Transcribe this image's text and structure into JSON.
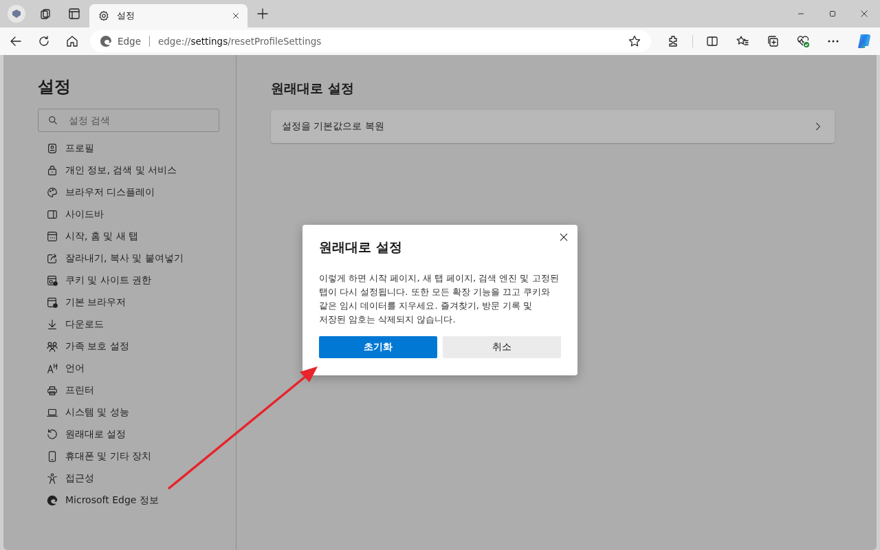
{
  "window": {
    "tabs": [
      {
        "label": "설정",
        "selected": true
      }
    ],
    "address": {
      "site_label": "Edge",
      "url_prefix": "edge://",
      "url_host": "settings",
      "url_path": "/resetProfileSettings"
    }
  },
  "sidebar": {
    "title": "설정",
    "search": {
      "placeholder": "설정 검색"
    },
    "items": [
      {
        "label": "프로필"
      },
      {
        "label": "개인 정보, 검색 및 서비스"
      },
      {
        "label": "브라우저 디스플레이"
      },
      {
        "label": "사이드바"
      },
      {
        "label": "시작, 홈 및 새 탭"
      },
      {
        "label": "잘라내기, 복사 및 붙여넣기"
      },
      {
        "label": "쿠키 및 사이트 권한"
      },
      {
        "label": "기본 브라우저"
      },
      {
        "label": "다운로드"
      },
      {
        "label": "가족 보호 설정"
      },
      {
        "label": "언어"
      },
      {
        "label": "프린터"
      },
      {
        "label": "시스템 및 성능"
      },
      {
        "label": "원래대로 설정"
      },
      {
        "label": "휴대폰 및 기타 장치"
      },
      {
        "label": "접근성"
      },
      {
        "label": "Microsoft Edge 정보"
      }
    ]
  },
  "main": {
    "title": "원래대로 설정",
    "rows": [
      {
        "label": "설정을 기본값으로 복원"
      }
    ]
  },
  "dialog": {
    "title": "원래대로 설정",
    "body": "이렇게 하면 시작 페이지, 새 탭 페이지, 검색 엔진 및 고정된 탭이 다시 설정됩니다. 또한 모든 확장 기능을 끄고 쿠키와 같은 임시 데이터를 지우세요. 즐겨찾기, 방문 기록 및 저장된 암호는 삭제되지 않습니다.",
    "buttons": [
      {
        "label": "초기화",
        "kind": "primary"
      },
      {
        "label": "취소",
        "kind": "secondary"
      }
    ]
  }
}
